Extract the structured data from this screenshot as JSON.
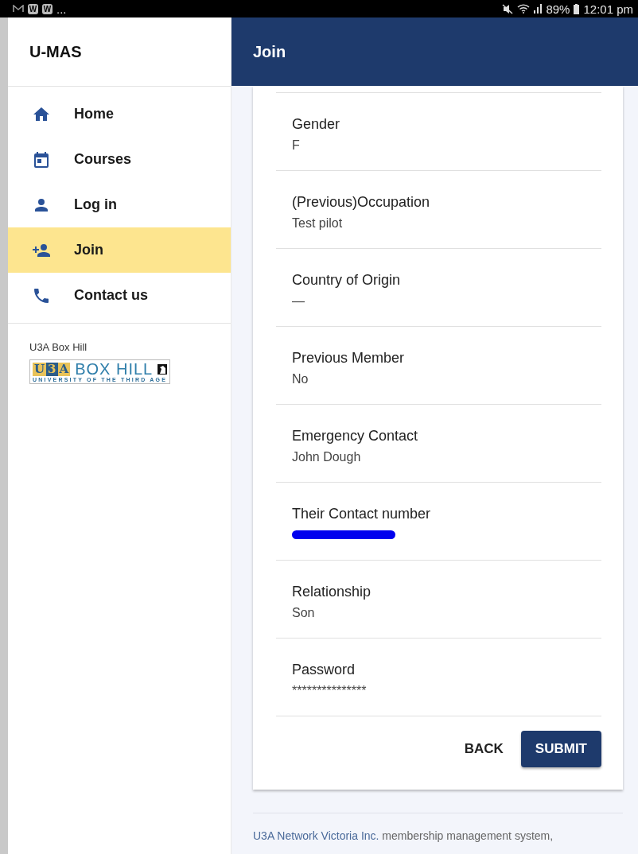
{
  "status_bar": {
    "app_letters": [
      "W",
      "W"
    ],
    "more": "...",
    "battery": "89%",
    "time": "12:01 pm"
  },
  "sidebar": {
    "title": "U-MAS",
    "items": [
      {
        "label": "Home",
        "selected": false
      },
      {
        "label": "Courses",
        "selected": false
      },
      {
        "label": "Log in",
        "selected": false
      },
      {
        "label": "Join",
        "selected": true
      },
      {
        "label": "Contact us",
        "selected": false
      }
    ],
    "org_name": "U3A Box Hill",
    "logo": {
      "mark_letters": [
        "U",
        "3",
        "A"
      ],
      "name": "BOX HILL",
      "tagline": "UNIVERSITY OF THE THIRD AGE"
    }
  },
  "header": {
    "title": "Join"
  },
  "fields": [
    {
      "label": "Gender",
      "value": "F",
      "redacted": false
    },
    {
      "label": "(Previous)Occupation",
      "value": "Test pilot",
      "redacted": false
    },
    {
      "label": "Country of Origin",
      "value": "—",
      "redacted": false
    },
    {
      "label": "Previous Member",
      "value": "No",
      "redacted": false
    },
    {
      "label": "Emergency Contact",
      "value": "John Dough",
      "redacted": false
    },
    {
      "label": "Their Contact number",
      "redacted": true
    },
    {
      "label": "Relationship",
      "value": "Son",
      "redacted": false
    },
    {
      "label": "Password",
      "value": "***************",
      "redacted": false
    }
  ],
  "buttons": {
    "back": "BACK",
    "submit": "SUBMIT"
  },
  "footer": {
    "link": "U3A Network Victoria Inc.",
    "text": "membership management system,"
  }
}
